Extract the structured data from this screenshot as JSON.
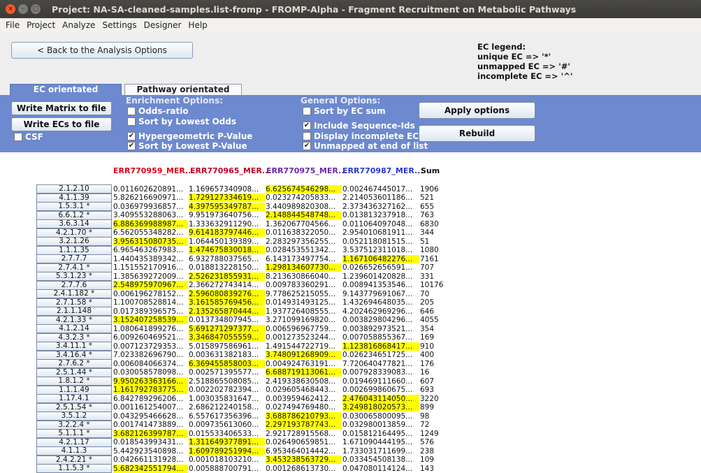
{
  "window": {
    "title": "Project: NA-SA-cleaned-samples.list-fromp - FROMP-Alpha - Fragment Recruitment on Metabolic Pathways"
  },
  "menu": [
    "File",
    "Project",
    "Analyze",
    "Settings",
    "Designer",
    "Help"
  ],
  "back_button": "< Back to the Analysis Options",
  "legend": [
    "EC legend:",
    "unique EC => '*'",
    "unmapped EC => '#'",
    "incomplete EC => '^'"
  ],
  "tabs": {
    "ec": "EC orientated",
    "pathway": "Pathway orientated"
  },
  "buttons": {
    "write_matrix": "Write Matrix to file",
    "write_ecs": "Write ECs to file",
    "apply": "Apply options",
    "rebuild": "Rebuild"
  },
  "csf": {
    "label": "CSF",
    "checked": false
  },
  "enrichment": {
    "title": "Enrichment Options:",
    "items": [
      {
        "label": "Odds-ratio",
        "checked": false
      },
      {
        "label": "Sort by Lowest Odds",
        "checked": false
      },
      {
        "label": "Hypergeometric P-Value",
        "checked": true
      },
      {
        "label": "Sort by Lowest P-Value",
        "checked": true
      }
    ]
  },
  "general": {
    "title": "General Options:",
    "items": [
      {
        "label": "Sort by EC sum",
        "checked": false
      },
      {
        "label": "Include Sequence-Ids",
        "checked": true
      },
      {
        "label": "Display incomplete ECs",
        "checked": false
      },
      {
        "label": "Unmapped at end of list",
        "checked": true
      }
    ]
  },
  "columns": [
    {
      "label": "ERR770959_MER...",
      "color": "#e0001a"
    },
    {
      "label": "ERR770965_MER...",
      "color": "#c0002a"
    },
    {
      "label": "ERR770975_MER...",
      "color": "#6a2aa8"
    },
    {
      "label": "ERR770987_MER...",
      "color": "#2a3ad0"
    },
    {
      "label": "Sum",
      "color": "#111111"
    }
  ],
  "rows": [
    {
      "ec": "2.1.2.10",
      "v": [
        "0.011602620891...",
        "1.169657340908...",
        "6.625674546298...",
        "0.002467445017...",
        "1906"
      ],
      "hl": 2
    },
    {
      "ec": "4.1.1.39",
      "v": [
        "5.826216690971...",
        "1.729127334619...",
        "0.023274205833...",
        "2.214053601186...",
        "521"
      ],
      "hl": 1
    },
    {
      "ec": "1.5.3.1 *",
      "v": [
        "0.036979936857...",
        "4.397595349787...",
        "3.440989820308...",
        "2.373436327162...",
        "655"
      ],
      "hl": 1
    },
    {
      "ec": "6.6.1.2 *",
      "v": [
        "3.409553288063...",
        "9.951973640756...",
        "2.148844548748...",
        "0.013813237918...",
        "763"
      ],
      "hl": 2
    },
    {
      "ec": "3.6.3.14",
      "v": [
        "6.886369988987...",
        "1.333632911290...",
        "1.362067704566...",
        "0.011064097048...",
        "6830"
      ],
      "hl": 0
    },
    {
      "ec": "4.2.1.70 *",
      "v": [
        "6.562055348282...",
        "9.614183797446...",
        "0.011638322050...",
        "2.954010681911...",
        "344"
      ],
      "hl": 1
    },
    {
      "ec": "3.2.1.26",
      "v": [
        "3.956315080735...",
        "1.064450139389...",
        "2.283297356255...",
        "0.052118081515...",
        "51"
      ],
      "hl": 0
    },
    {
      "ec": "1.1.1.35",
      "v": [
        "6.965463267983...",
        "1.474675830018...",
        "0.028453551342...",
        "3.537512311018...",
        "1080"
      ],
      "hl": 1
    },
    {
      "ec": "2.7.7.7",
      "v": [
        "1.440435389342...",
        "6.932788037565...",
        "6.143173497754...",
        "1.167106482276...",
        "7161"
      ],
      "hl": 3
    },
    {
      "ec": "2.7.4.1 *",
      "v": [
        "1.151552170916...",
        "0.018813228150...",
        "1.298134607730...",
        "0.026652656591...",
        "707"
      ],
      "hl": 2
    },
    {
      "ec": "5.3.1.23 *",
      "v": [
        "1.385639272009...",
        "2.526231855931...",
        "8.213630866040...",
        "1.239601420828...",
        "331"
      ],
      "hl": 1
    },
    {
      "ec": "2.7.7.6",
      "v": [
        "2.548975970967...",
        "2.366272743414...",
        "0.009783360291...",
        "0.008941353546...",
        "10176"
      ],
      "hl": 0
    },
    {
      "ec": "2.4.1.182 *",
      "v": [
        "0.006196278152...",
        "2.596080839276...",
        "9.778625215055...",
        "9.143779691067...",
        "70"
      ],
      "hl": 1
    },
    {
      "ec": "2.7.1.58 *",
      "v": [
        "1.100708528814...",
        "3.161585769456...",
        "0.014931493125...",
        "1.432694648035...",
        "205"
      ],
      "hl": 1
    },
    {
      "ec": "2.1.1.148",
      "v": [
        "0.017389396575...",
        "2.135265870444...",
        "1.937726408555...",
        "4.202462969296...",
        "646"
      ],
      "hl": 1
    },
    {
      "ec": "4.2.1.33 *",
      "v": [
        "3.152407258539...",
        "0.013734807945...",
        "3.271099169820...",
        "0.003829804296...",
        "4055"
      ],
      "hl": 0
    },
    {
      "ec": "4.1.2.14",
      "v": [
        "1.080641899276...",
        "5.691271297377...",
        "0.006596967759...",
        "0.003892973521...",
        "354"
      ],
      "hl": 1
    },
    {
      "ec": "4.3.2.3 *",
      "v": [
        "6.009260469521...",
        "3.346847055559...",
        "0.001273523244...",
        "0.007058855367...",
        "169"
      ],
      "hl": 1
    },
    {
      "ec": "3.4.11.1 *",
      "v": [
        "0.007123729353...",
        "5.015897586961...",
        "1.491544722719...",
        "1.123816868417...",
        "910"
      ],
      "hl": 3
    },
    {
      "ec": "3.4.16.4 *",
      "v": [
        "7.023382696790...",
        "0.003631382183...",
        "3.748091268909...",
        "0.026234651725...",
        "400"
      ],
      "hl": 2
    },
    {
      "ec": "2.7.6.2 *",
      "v": [
        "0.006084066374...",
        "6.369455858003...",
        "0.004924763191...",
        "7.720640477821...",
        "176"
      ],
      "hl": 1
    },
    {
      "ec": "2.5.1.44 *",
      "v": [
        "0.030058578098...",
        "0.002571395577...",
        "6.688719113061...",
        "0.007928339083...",
        "16"
      ],
      "hl": 2
    },
    {
      "ec": "1.8.1.2 *",
      "v": [
        "9.950263363166...",
        "2.518865508085...",
        "2.419338630508...",
        "0.019469111660...",
        "607"
      ],
      "hl": 0
    },
    {
      "ec": "1.1.1.49",
      "v": [
        "1.161792783775...",
        "0.002202782394...",
        "0.029605468443...",
        "0.002699860675...",
        "693"
      ],
      "hl": 0
    },
    {
      "ec": "1.17.4.1",
      "v": [
        "6.842789296206...",
        "1.003035831647...",
        "0.003959462412...",
        "2.476043114050...",
        "3220"
      ],
      "hl": 3
    },
    {
      "ec": "2.5.1.54 *",
      "v": [
        "0.001161254007...",
        "2.686212240158...",
        "0.027494769480...",
        "3.249818020573...",
        "899"
      ],
      "hl": 3
    },
    {
      "ec": "3.5.1.2",
      "v": [
        "0.043295466628...",
        "6.557617356396...",
        "3.688786210793...",
        "0.030065800095...",
        "98"
      ],
      "hl": 2
    },
    {
      "ec": "3.2.2.4 *",
      "v": [
        "0.001741473889...",
        "0.009735613060...",
        "2.297193787743...",
        "0.032980013859...",
        "72"
      ],
      "hl": 2
    },
    {
      "ec": "5.1.1.1 *",
      "v": [
        "3.682126399787...",
        "0.015533406533...",
        "2.921728915568...",
        "0.015812164495...",
        "1249"
      ],
      "hl": 0
    },
    {
      "ec": "4.2.1.17",
      "v": [
        "0.018543993431...",
        "1.311649377891...",
        "0.026490659851...",
        "1.671090444195...",
        "576"
      ],
      "hl": 1
    },
    {
      "ec": "4.1.1.3",
      "v": [
        "5.442923540898...",
        "1.609789251994...",
        "6.953464014442...",
        "1.733031711699...",
        "238"
      ],
      "hl": 1
    },
    {
      "ec": "2.4.2.21 *",
      "v": [
        "0.042661131928...",
        "0.001018103210...",
        "3.453238563729...",
        "0.033454508138...",
        "109"
      ],
      "hl": 2
    },
    {
      "ec": "1.1.5.3 *",
      "v": [
        "5.682342551794...",
        "0.005888700791...",
        "0.001268613730...",
        "0.047080114124...",
        "143"
      ],
      "hl": 0
    }
  ]
}
